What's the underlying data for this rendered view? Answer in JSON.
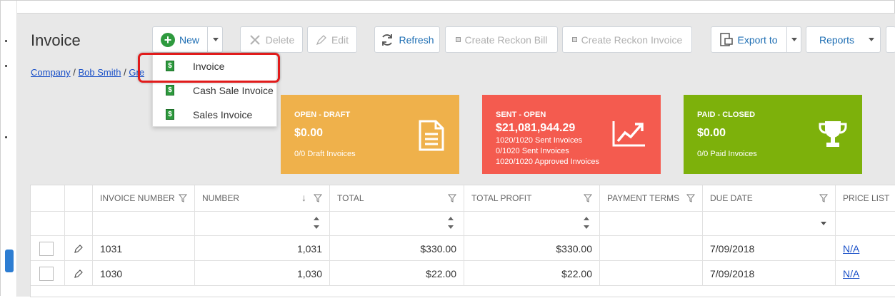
{
  "page": {
    "title": "Invoice"
  },
  "breadcrumb": {
    "items": [
      "Company",
      "Bob Smith",
      "Gre"
    ],
    "separator": "/"
  },
  "toolbar": {
    "new_label": "New",
    "delete_label": "Delete",
    "edit_label": "Edit",
    "refresh_label": "Refresh",
    "reckon_bill_label": "Create Reckon Bill",
    "reckon_invoice_label": "Create Reckon Invoice",
    "export_label": "Export to",
    "reports_label": "Reports"
  },
  "new_menu": {
    "items": [
      {
        "label": "Invoice",
        "icon": "invoice-doc-icon"
      },
      {
        "label": "Cash Sale Invoice",
        "icon": "invoice-doc-icon"
      },
      {
        "label": "Sales Invoice",
        "icon": "invoice-doc-icon"
      }
    ]
  },
  "cards": [
    {
      "label": "OPEN - DRAFT",
      "amount": "$0.00",
      "lines": [
        "0/0 Draft Invoices"
      ],
      "color": "#efb14b",
      "icon": "document-icon"
    },
    {
      "label": "SENT - OPEN",
      "amount": "$21,081,944.29",
      "lines": [
        "1020/1020 Sent Invoices",
        "0/1020 Sent Invoices",
        "1020/1020 Approved Invoices"
      ],
      "color": "#f45b4f",
      "icon": "trend-chart-icon"
    },
    {
      "label": "PAID - CLOSED",
      "amount": "$0.00",
      "lines": [
        "0/0 Paid Invoices"
      ],
      "color": "#7db10b",
      "icon": "trophy-icon"
    }
  ],
  "table": {
    "columns": [
      "INVOICE NUMBER",
      "NUMBER",
      "TOTAL",
      "TOTAL PROFIT",
      "PAYMENT TERMS",
      "DUE DATE",
      "PRICE LIST"
    ],
    "rows": [
      {
        "invoice_number": "1031",
        "number": "1,031",
        "total": "$330.00",
        "total_profit": "$330.00",
        "payment_terms": "",
        "due_date": "7/09/2018",
        "price_list": "N/A"
      },
      {
        "invoice_number": "1030",
        "number": "1,030",
        "total": "$22.00",
        "total_profit": "$22.00",
        "payment_terms": "",
        "due_date": "7/09/2018",
        "price_list": "N/A"
      }
    ]
  },
  "colors": {
    "link": "#1a50c8",
    "highlight": "#e11b1b",
    "new_green": "#2e9a3e"
  }
}
